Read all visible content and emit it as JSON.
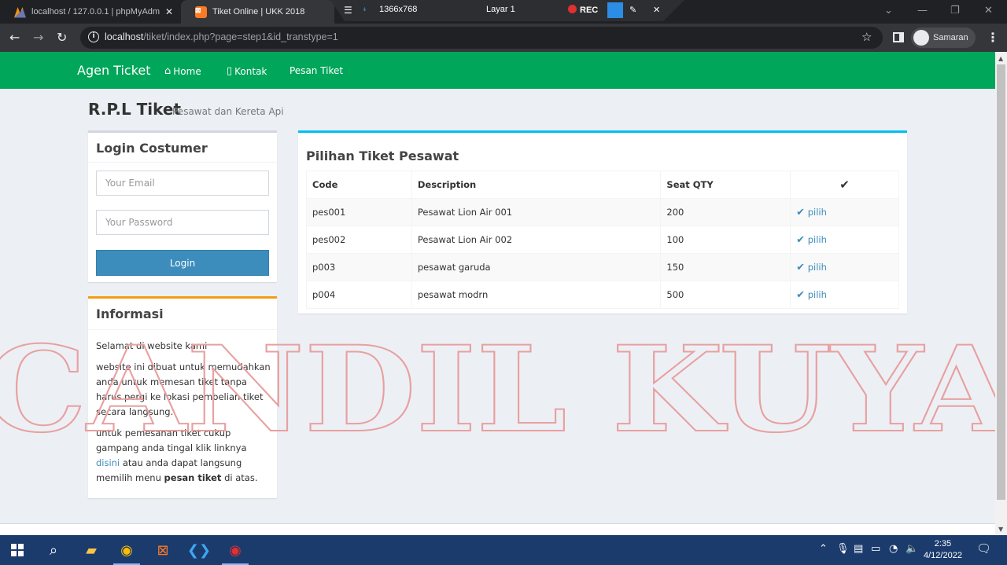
{
  "browser": {
    "tabs": [
      {
        "title": "localhost / 127.0.0.1 | phpMyAdm",
        "active": false
      },
      {
        "title": "Tiket Online | UKK 2018",
        "active": true
      }
    ],
    "close_glyph": "✕",
    "url_host": "localhost",
    "url_path": "/tiket/index.php?page=step1&id_transtype=1",
    "profile_name": "Samaran",
    "icons": [
      "back-icon",
      "forward-icon",
      "reload-icon",
      "info-icon",
      "star-icon",
      "side-panel-icon",
      "menu-icon"
    ]
  },
  "recorder": {
    "resolution": "1366x768",
    "layer": "Layar 1",
    "rec_label": "REC"
  },
  "navbar": {
    "brand": "Agen Ticket",
    "links": [
      "Home",
      "Kontak",
      "Pesan Tiket"
    ],
    "color": "#00a65a"
  },
  "header": {
    "title": "R.P.L Tiket",
    "subtitle": "Pesawat dan Kereta Api"
  },
  "login": {
    "title": "Login Costumer",
    "email_placeholder": "Your Email",
    "password_placeholder": "Your Password",
    "button_label": "Login",
    "button_color": "#3c8dbc"
  },
  "info": {
    "title": "Informasi",
    "p1": "Selamat di website kami",
    "p2": "website ini dibuat untuk memudahkan anda untuk memesan tiket tanpa harus pergi ke lokasi pembelian tiket secara langsung.",
    "p3_a": "untuk pemesanan tiket cukup gampang anda tingal klik linknya ",
    "p3_link": "disini",
    "p3_b": " atau anda dapat langsung memilih menu ",
    "p3_bold": "pesan tiket",
    "p3_c": " di atas."
  },
  "tiket": {
    "title": "Pilihan Tiket Pesawat",
    "columns": [
      "Code",
      "Description",
      "Seat QTY",
      "✔"
    ],
    "rows": [
      {
        "code": "pes001",
        "description": "Pesawat Lion Air 001",
        "seat": "200",
        "action": "pilih"
      },
      {
        "code": "pes002",
        "description": "Pesawat Lion Air 002",
        "seat": "100",
        "action": "pilih"
      },
      {
        "code": "p003",
        "description": "pesawat garuda",
        "seat": "150",
        "action": "pilih"
      },
      {
        "code": "p004",
        "description": "pesawat modrn",
        "seat": "500",
        "action": "pilih"
      }
    ]
  },
  "watermark": "CANDIL KUYA",
  "taskbar": {
    "time": "2:35",
    "date": "4/12/2022"
  }
}
